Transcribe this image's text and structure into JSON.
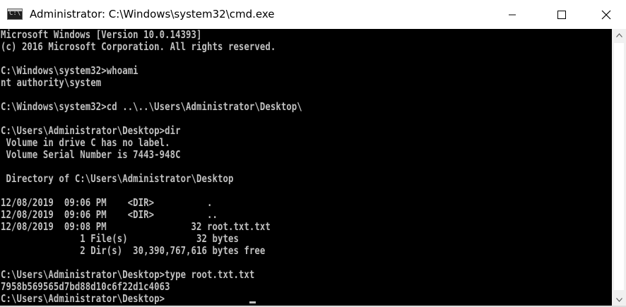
{
  "window": {
    "title": "Administrator: C:\\Windows\\system32\\cmd.exe",
    "app_icon": "console-icon",
    "icon_text": "C:\\",
    "controls": {
      "minimize": "minimize-icon",
      "maximize": "maximize-icon",
      "close": "close-icon"
    }
  },
  "console": {
    "foreground": "#c0c0c0",
    "background": "#000000",
    "lines": [
      "Microsoft Windows [Version 10.0.14393]",
      "(c) 2016 Microsoft Corporation. All rights reserved.",
      "",
      "C:\\Windows\\system32>whoami",
      "nt authority\\system",
      "",
      "C:\\Windows\\system32>cd ..\\..\\Users\\Administrator\\Desktop\\",
      "",
      "C:\\Users\\Administrator\\Desktop>dir",
      " Volume in drive C has no label.",
      " Volume Serial Number is 7443-948C",
      "",
      " Directory of C:\\Users\\Administrator\\Desktop",
      "",
      "12/08/2019  09:06 PM    <DIR>          .",
      "12/08/2019  09:06 PM    <DIR>          ..",
      "12/08/2019  09:08 PM                32 root.txt.txt",
      "               1 File(s)             32 bytes",
      "               2 Dir(s)  30,390,767,616 bytes free",
      "",
      "C:\\Users\\Administrator\\Desktop>type root.txt.txt",
      "7958b569565d7bd88d10c6f22d1c4063",
      "C:\\Users\\Administrator\\Desktop>"
    ]
  },
  "scrollbar": {
    "up": "scroll-up-arrow-icon",
    "down": "scroll-down-arrow-icon"
  }
}
